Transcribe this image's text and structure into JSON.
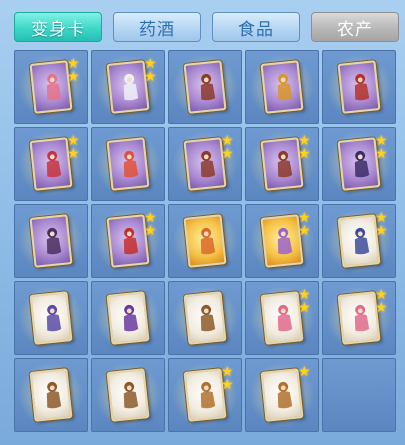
{
  "tabs": [
    {
      "label": "变身卡",
      "state": "active"
    },
    {
      "label": "药酒",
      "state": "normal"
    },
    {
      "label": "食品",
      "state": "normal"
    },
    {
      "label": "农产",
      "state": "disabled"
    }
  ],
  "colors": {
    "active_tab": "#3fd7c8",
    "normal_tab": "#b6d6f2",
    "disabled_tab": "#b8b8b8",
    "slot": "#6388c2",
    "star": "#ffd21f"
  },
  "inventory": [
    {
      "card": "purple",
      "icon": "pink-flower-fairy-icon",
      "fig": "#e5738a",
      "stars": 2
    },
    {
      "card": "purple",
      "icon": "white-fox-warrior-icon",
      "fig": "#eef0f8",
      "stars": 2
    },
    {
      "card": "purple",
      "icon": "bat-demon-icon",
      "fig": "#8c3a2a",
      "stars": 0
    },
    {
      "card": "purple",
      "icon": "golden-bull-icon",
      "fig": "#d9952a",
      "stars": 0
    },
    {
      "card": "purple",
      "icon": "red-warrior-icon",
      "fig": "#b5322a",
      "stars": 0
    },
    {
      "card": "purple",
      "icon": "fire-bird-icon",
      "fig": "#c8333f",
      "stars": 2
    },
    {
      "card": "purple",
      "icon": "red-hair-girl-icon",
      "fig": "#e0503a",
      "stars": 0
    },
    {
      "card": "purple",
      "icon": "bat-demon-icon",
      "fig": "#8c3a2a",
      "stars": 2
    },
    {
      "card": "purple",
      "icon": "bat-demon-icon",
      "fig": "#8c3a2a",
      "stars": 2
    },
    {
      "card": "purple",
      "icon": "dark-sorcerer-icon",
      "fig": "#3a2c68",
      "stars": 2
    },
    {
      "card": "purple",
      "icon": "demon-warrior-icon",
      "fig": "#4a2f5e",
      "stars": 0
    },
    {
      "card": "purple",
      "icon": "red-dragon-icon",
      "fig": "#c2302a",
      "stars": 2
    },
    {
      "card": "gold",
      "icon": "fire-beast-icon",
      "fig": "#d9692a",
      "stars": 0
    },
    {
      "card": "gold",
      "icon": "butterfly-fairy-icon",
      "fig": "#9b63c8",
      "stars": 2
    },
    {
      "card": "white",
      "icon": "blue-mage-icon",
      "fig": "#3c4c9a",
      "stars": 2
    },
    {
      "card": "white",
      "icon": "blue-mage-icon",
      "fig": "#5a4aa8",
      "stars": 0
    },
    {
      "card": "white",
      "icon": "purple-knight-icon",
      "fig": "#6a3aa0",
      "stars": 0
    },
    {
      "card": "white",
      "icon": "brown-bear-icon",
      "fig": "#8c5a2a",
      "stars": 0
    },
    {
      "card": "white",
      "icon": "pink-hair-girl-icon",
      "fig": "#e06a8c",
      "stars": 2
    },
    {
      "card": "white",
      "icon": "pink-hair-girl-icon",
      "fig": "#e06a8c",
      "stars": 2
    },
    {
      "card": "white",
      "icon": "brown-bear-icon",
      "fig": "#8c5a2a",
      "stars": 0
    },
    {
      "card": "white",
      "icon": "brown-bear-icon",
      "fig": "#8c5a2a",
      "stars": 0
    },
    {
      "card": "white",
      "icon": "mountain-giant-icon",
      "fig": "#b0702a",
      "stars": 2
    },
    {
      "card": "white",
      "icon": "mountain-giant-icon",
      "fig": "#b0702a",
      "stars": 1
    },
    null
  ]
}
